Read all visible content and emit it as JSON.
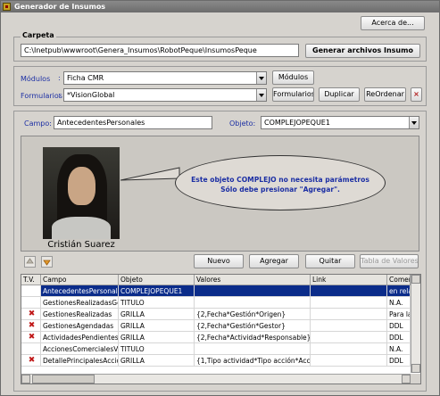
{
  "window": {
    "title": "Generador de Insumos"
  },
  "about_button": "Acerca de...",
  "carpeta": {
    "label": "Carpeta",
    "path": "C:\\Inetpub\\wwwroot\\Genera_Insumos\\RobotPeque\\InsumosPeque",
    "generate_button": "Generar archivos Insumo"
  },
  "modulos": {
    "label": "Módulos",
    "colon": ":",
    "value": "Ficha CMR",
    "button": "Módulos"
  },
  "formularios": {
    "label": "Formularios",
    "colon": ":",
    "value": "*VisionGlobal",
    "button": "Formularios",
    "duplicate_button": "Duplicar",
    "reorder_button": "ReOrdenar",
    "delete_button": "×"
  },
  "campo": {
    "label": "Campo:",
    "value": "AntecedentesPersonales"
  },
  "objeto": {
    "label": "Objeto:",
    "value": "COMPLEJOPEQUE1"
  },
  "photo": {
    "caption": "Cristián Suarez"
  },
  "bubble": {
    "line1": "Este objeto COMPLEJO no necesita parámetros",
    "line2": "Sólo debe presionar \"Agregar\"."
  },
  "actions": {
    "nuevo": "Nuevo",
    "agregar": "Agregar",
    "quitar": "Quitar",
    "tabla_valores": "Tabla de Valores"
  },
  "table": {
    "headers": [
      "T.V.",
      "Campo",
      "Objeto",
      "Valores",
      "Link",
      "Comen"
    ],
    "rows": [
      {
        "tv": "",
        "campo": "AntecedentesPersonales",
        "objeto": "COMPLEJOPEQUE1",
        "valores": "",
        "link": "",
        "comen": "en rela"
      },
      {
        "tv": "",
        "campo": "GestionesRealizadasGes",
        "objeto": "TITULO",
        "valores": "",
        "link": "",
        "comen": "N.A."
      },
      {
        "tv": "x",
        "campo": "GestionesRealizadas",
        "objeto": "GRILLA",
        "valores": "{2,Fecha*Gestión*Origen}",
        "link": "",
        "comen": "Para la"
      },
      {
        "tv": "x",
        "campo": "GestionesAgendadas",
        "objeto": "GRILLA",
        "valores": "{2,Fecha*Gestión*Gestor}",
        "link": "",
        "comen": "DDL"
      },
      {
        "tv": "x",
        "campo": "ActividadesPendientes",
        "objeto": "GRILLA",
        "valores": "{2,Fecha*Actividad*Responsable}",
        "link": "",
        "comen": "DDL"
      },
      {
        "tv": "",
        "campo": "AccionesComercialesVi",
        "objeto": "TITULO",
        "valores": "",
        "link": "",
        "comen": "N.A."
      },
      {
        "tv": "x",
        "campo": "DetallePrincipalesAccio",
        "objeto": "GRILLA",
        "valores": "{1,Tipo actividad*Tipo acción*Acció",
        "link": "",
        "comen": "DDL"
      }
    ]
  }
}
